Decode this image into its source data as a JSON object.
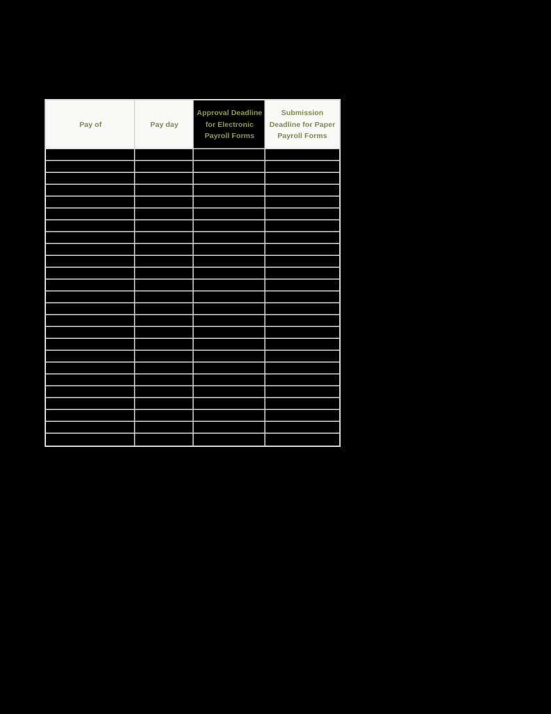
{
  "document": {
    "page_background": "#000000",
    "table_gridline_color": "#d6d6d6",
    "header_background": "#f8f8f6",
    "header_text_color": "#7d8c4e",
    "redacted_cell_color": "#000000"
  },
  "table": {
    "columns": [
      {
        "id": "pay-of",
        "label": "Pay of",
        "background": "#f8f8f6",
        "redacted_header": false
      },
      {
        "id": "pay-day",
        "label": "Pay day",
        "background": "#f8f8f6",
        "redacted_header": false
      },
      {
        "id": "approval-deadline-electronic",
        "label": "Approval Deadline for Electronic Payroll Forms",
        "background": "#000000",
        "redacted_header": true
      },
      {
        "id": "submission-deadline-paper",
        "label": "Submission Deadline for Paper Payroll Forms",
        "background": "#f8f8f6",
        "redacted_header": false
      }
    ],
    "row_count": 25,
    "rows": [
      [
        "",
        "",
        "",
        ""
      ],
      [
        "",
        "",
        "",
        ""
      ],
      [
        "",
        "",
        "",
        ""
      ],
      [
        "",
        "",
        "",
        ""
      ],
      [
        "",
        "",
        "",
        ""
      ],
      [
        "",
        "",
        "",
        ""
      ],
      [
        "",
        "",
        "",
        ""
      ],
      [
        "",
        "",
        "",
        ""
      ],
      [
        "",
        "",
        "",
        ""
      ],
      [
        "",
        "",
        "",
        ""
      ],
      [
        "",
        "",
        "",
        ""
      ],
      [
        "",
        "",
        "",
        ""
      ],
      [
        "",
        "",
        "",
        ""
      ],
      [
        "",
        "",
        "",
        ""
      ],
      [
        "",
        "",
        "",
        ""
      ],
      [
        "",
        "",
        "",
        ""
      ],
      [
        "",
        "",
        "",
        ""
      ],
      [
        "",
        "",
        "",
        ""
      ],
      [
        "",
        "",
        "",
        ""
      ],
      [
        "",
        "",
        "",
        ""
      ],
      [
        "",
        "",
        "",
        ""
      ],
      [
        "",
        "",
        "",
        ""
      ],
      [
        "",
        "",
        "",
        ""
      ],
      [
        "",
        "",
        "",
        ""
      ],
      [
        "",
        "",
        "",
        ""
      ]
    ]
  }
}
